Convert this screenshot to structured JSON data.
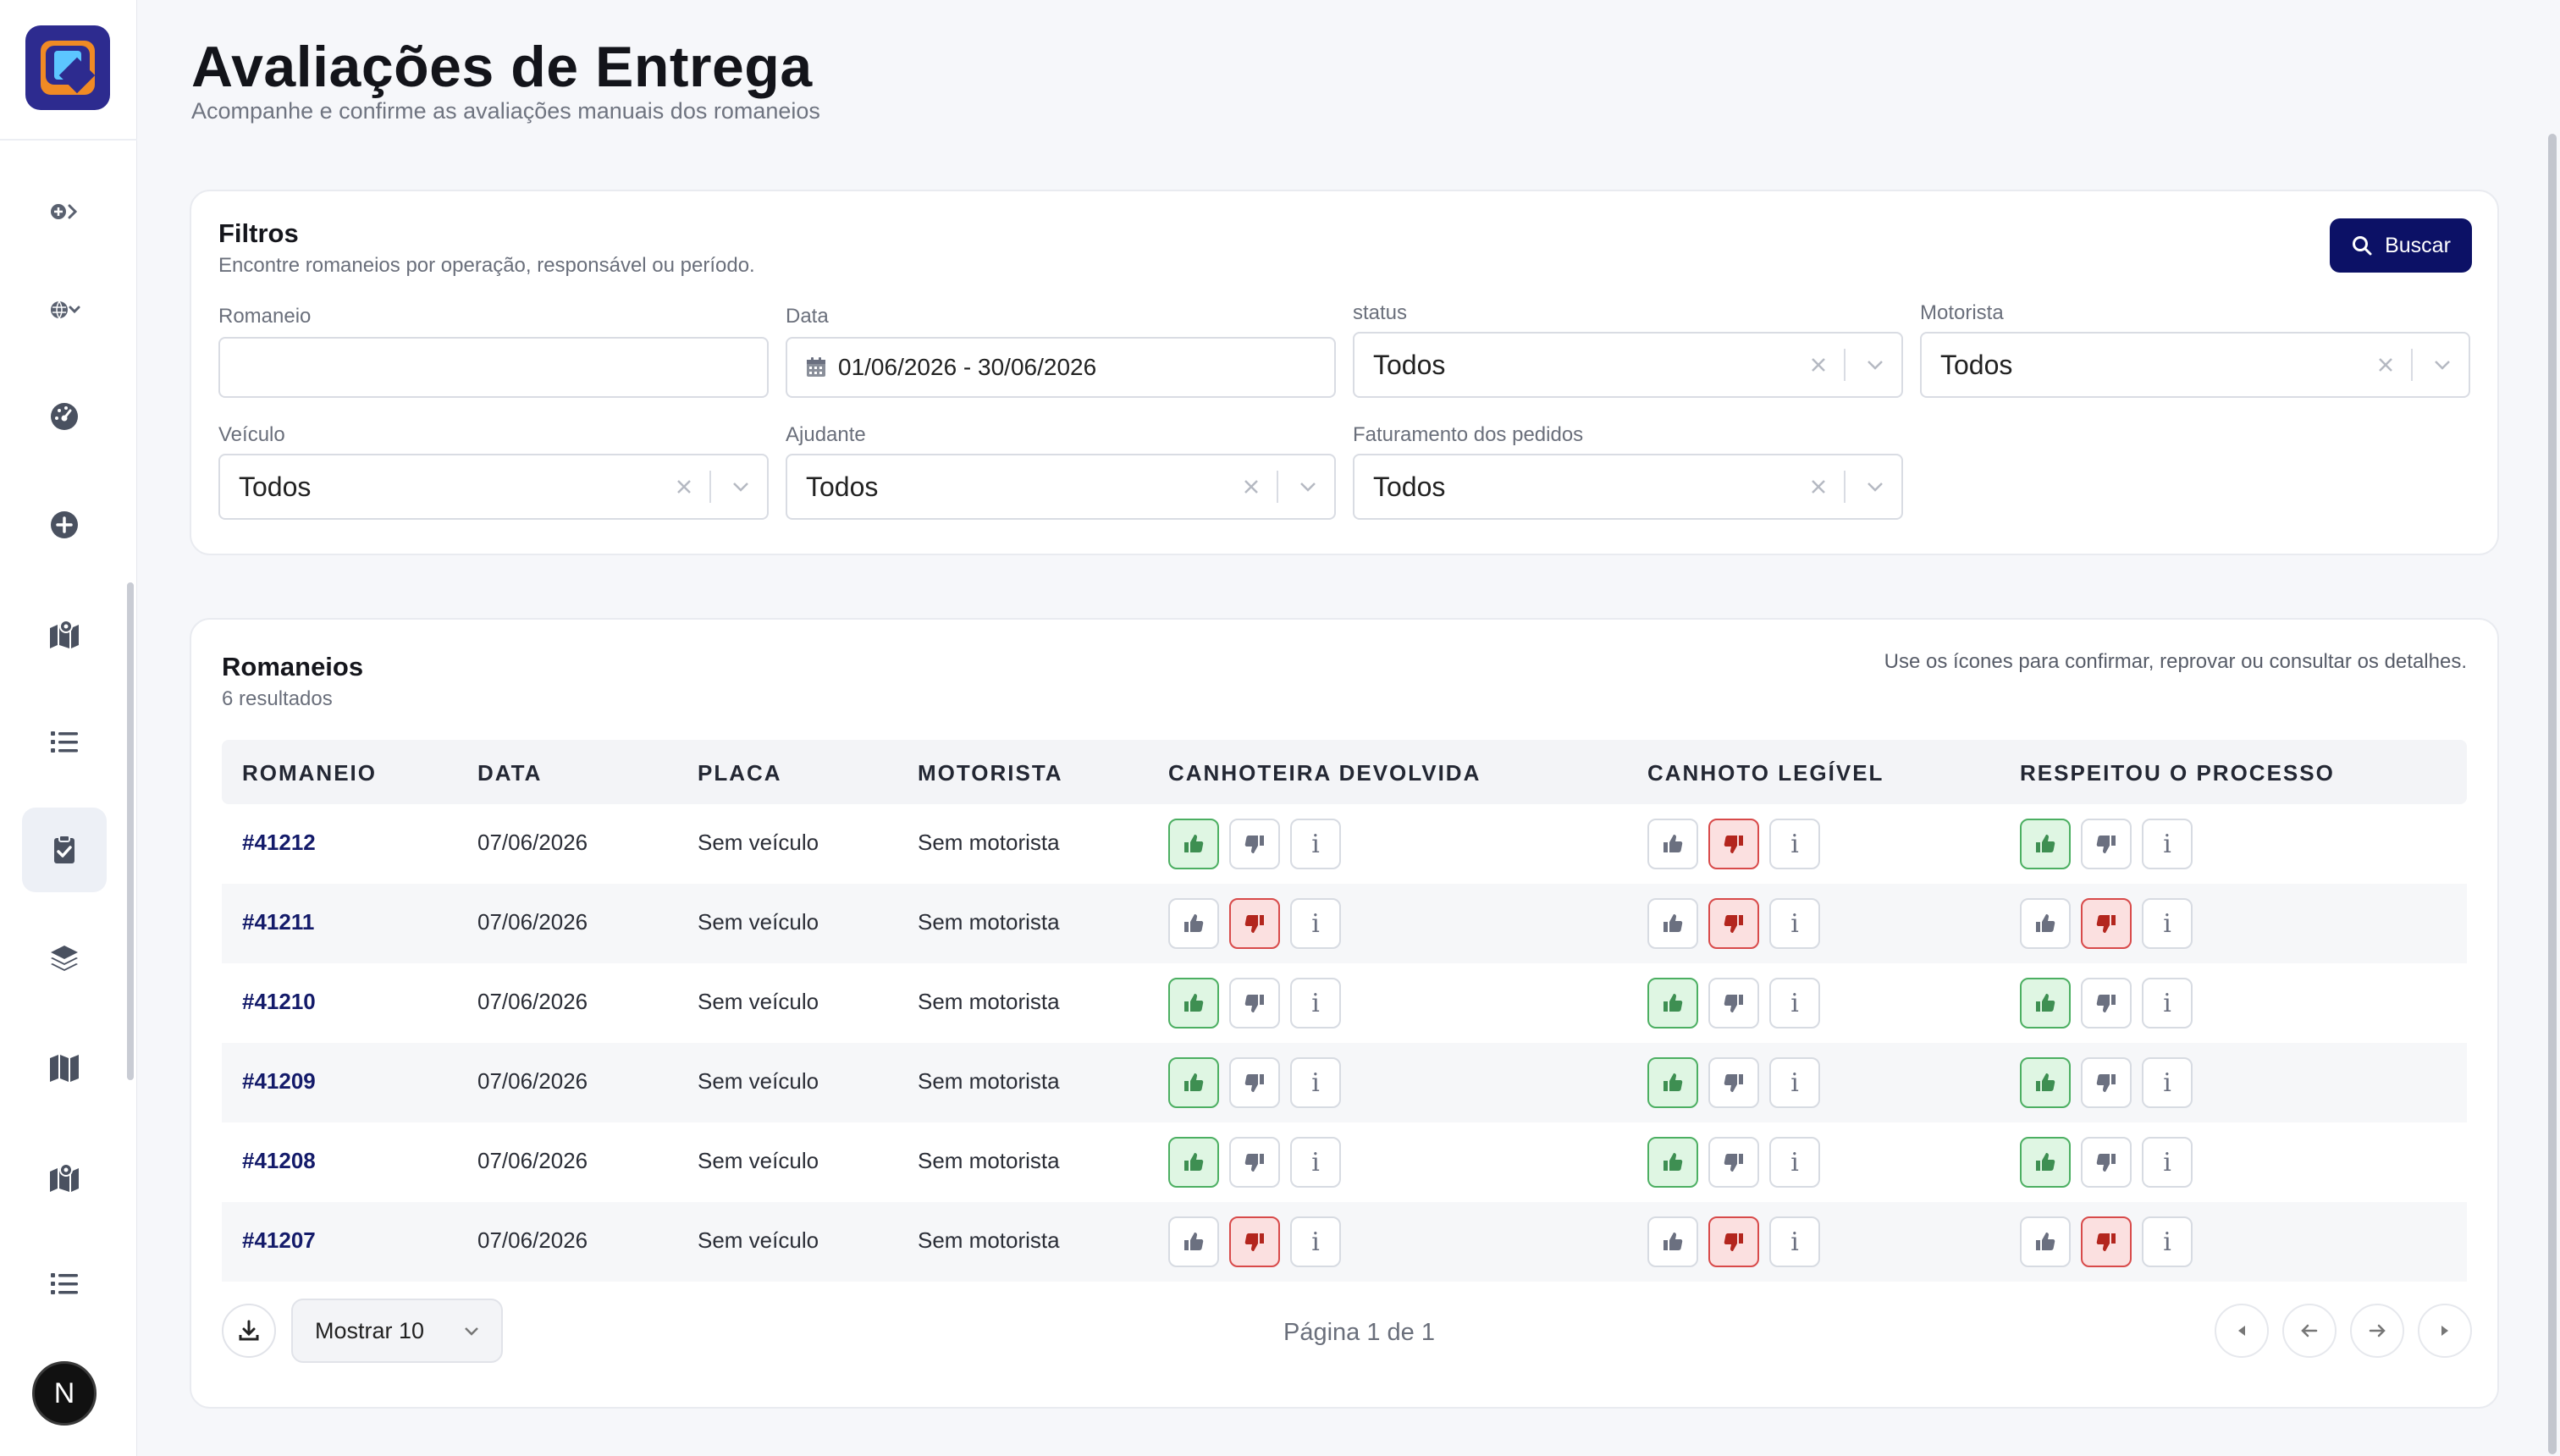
{
  "app": {
    "title": "Avaliações de Entrega",
    "subtitle": "Acompanhe e confirme as avaliações manuais dos romaneios",
    "avatar_initial": "N",
    "sidebar_icons": [
      "plus-chevron-icon",
      "globe-chevron-icon",
      "dashboard-icon",
      "add-circle-icon",
      "map-marker-icon",
      "list-icon",
      "clipboard-check-icon",
      "layers-icon",
      "map-icon",
      "map-marker-icon",
      "list-icon"
    ]
  },
  "filters": {
    "title": "Filtros",
    "subtitle": "Encontre romaneios por operação, responsável ou período.",
    "search_button": "Buscar",
    "romaneio": {
      "label": "Romaneio",
      "value": ""
    },
    "data": {
      "label": "Data",
      "value": "01/06/2026 - 30/06/2026"
    },
    "status": {
      "label": "status",
      "value": "Todos"
    },
    "motorista": {
      "label": "Motorista",
      "value": "Todos"
    },
    "veiculo": {
      "label": "Veículo",
      "value": "Todos"
    },
    "ajudante": {
      "label": "Ajudante",
      "value": "Todos"
    },
    "faturamento": {
      "label": "Faturamento dos pedidos",
      "value": "Todos"
    }
  },
  "results": {
    "title": "Romaneios",
    "count": "6 resultados",
    "hint": "Use os ícones para confirmar, reprovar ou consultar os detalhes.",
    "columns": [
      "ROMANEIO",
      "DATA",
      "PLACA",
      "MOTORISTA",
      "CANHOTEIRA DEVOLVIDA",
      "CANHOTO LEGÍVEL",
      "RESPEITOU O PROCESSO"
    ],
    "rows": [
      {
        "id": "#41212",
        "data": "07/06/2026",
        "placa": "Sem veículo",
        "motorista": "Sem motorista",
        "canhoteira": "up",
        "canhoto": "down",
        "processo": "up"
      },
      {
        "id": "#41211",
        "data": "07/06/2026",
        "placa": "Sem veículo",
        "motorista": "Sem motorista",
        "canhoteira": "down",
        "canhoto": "down",
        "processo": "down"
      },
      {
        "id": "#41210",
        "data": "07/06/2026",
        "placa": "Sem veículo",
        "motorista": "Sem motorista",
        "canhoteira": "up",
        "canhoto": "up",
        "processo": "up"
      },
      {
        "id": "#41209",
        "data": "07/06/2026",
        "placa": "Sem veículo",
        "motorista": "Sem motorista",
        "canhoteira": "up",
        "canhoto": "up",
        "processo": "up"
      },
      {
        "id": "#41208",
        "data": "07/06/2026",
        "placa": "Sem veículo",
        "motorista": "Sem motorista",
        "canhoteira": "up",
        "canhoto": "up",
        "processo": "up"
      },
      {
        "id": "#41207",
        "data": "07/06/2026",
        "placa": "Sem veículo",
        "motorista": "Sem motorista",
        "canhoteira": "down",
        "canhoto": "down",
        "processo": "down"
      }
    ],
    "page_size_label": "Mostrar 10",
    "pagination_text": "Página 1 de 1"
  },
  "colors": {
    "primary": "#0c1166",
    "approve": "#3e8f52",
    "reject": "#b3261e",
    "neutral_icon": "#6b7080"
  }
}
